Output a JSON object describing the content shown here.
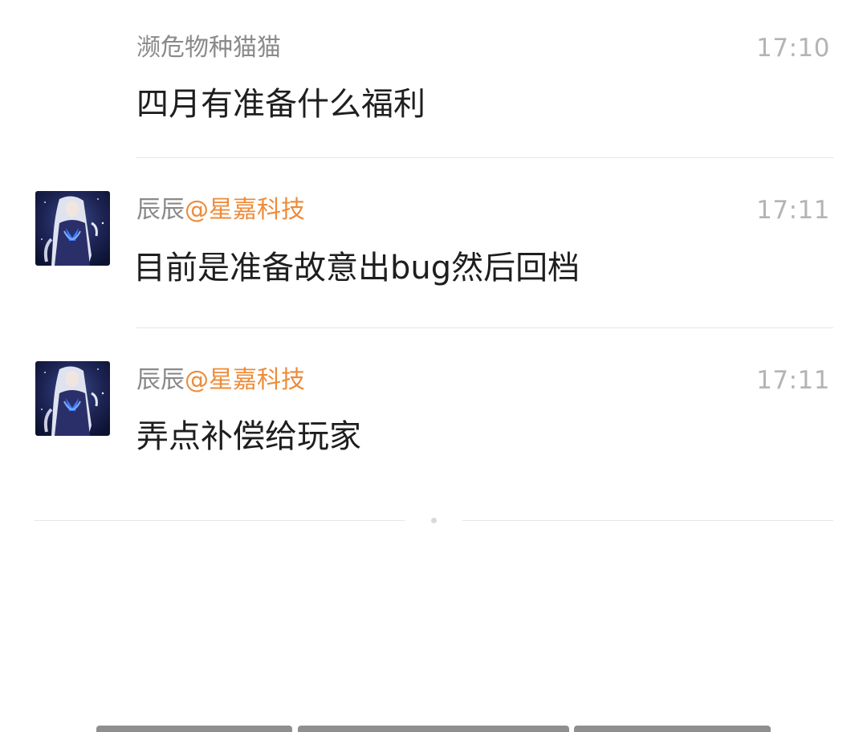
{
  "messages": [
    {
      "sender_name": "濒危物种猫猫",
      "sender_org": "",
      "time": "17:10",
      "text": "四月有准备什么福利",
      "has_avatar": false
    },
    {
      "sender_name": "辰辰",
      "sender_org": "@星嘉科技",
      "time": "17:11",
      "text": "目前是准备故意出bug然后回档",
      "has_avatar": true
    },
    {
      "sender_name": "辰辰",
      "sender_org": "@星嘉科技",
      "time": "17:11",
      "text": "弄点补偿给玩家",
      "has_avatar": true
    }
  ],
  "colors": {
    "org_accent": "#ee8b3a",
    "sender_gray": "#8a8a8a",
    "time_gray": "#b4b4b4",
    "text": "#1e1e1e",
    "divider": "#e6e6e6"
  },
  "icons": {
    "avatar": "avatar-anime-character",
    "end_marker": "end-of-list-dot"
  }
}
